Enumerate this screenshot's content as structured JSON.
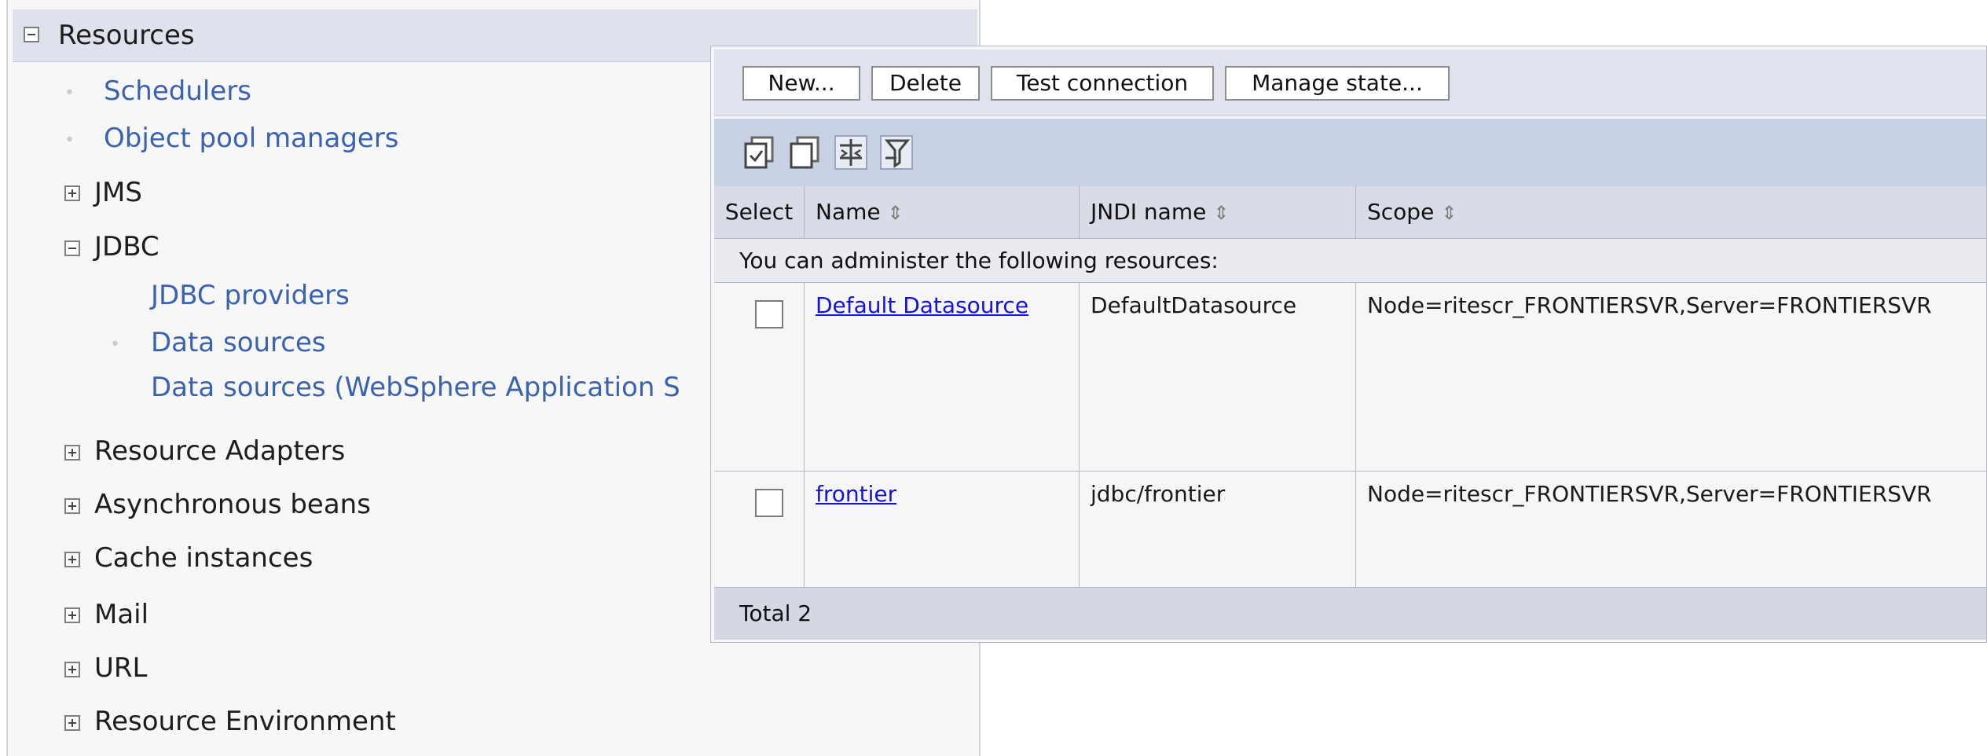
{
  "nav": {
    "header": {
      "label": "Resources"
    },
    "scheduling_links": [
      {
        "label": "Schedulers"
      },
      {
        "label": "Object pool managers"
      }
    ],
    "jms": {
      "label": "JMS"
    },
    "jdbc": {
      "label": "JDBC",
      "children": [
        {
          "label": "JDBC providers"
        },
        {
          "label": "Data sources"
        },
        {
          "label": "Data sources (WebSphere Application S"
        }
      ]
    },
    "more_categories": [
      {
        "label": "Resource Adapters"
      },
      {
        "label": "Asynchronous beans"
      },
      {
        "label": "Cache instances"
      },
      {
        "label": "Mail"
      },
      {
        "label": "URL"
      },
      {
        "label": "Resource Environment"
      }
    ]
  },
  "panel": {
    "buttons": [
      {
        "label": "New..."
      },
      {
        "label": "Delete"
      },
      {
        "label": "Test connection"
      },
      {
        "label": "Manage state..."
      }
    ],
    "icon_buttons": [
      "select-all-icon",
      "deselect-all-icon",
      "show-filter-icon",
      "clear-filter-icon"
    ],
    "columns": {
      "select": "Select",
      "name": "Name",
      "jndi": "JNDI name",
      "scope": "Scope",
      "sort_icon": "⇕"
    },
    "admin_note": "You can administer the following resources:",
    "rows": [
      {
        "name": "Default Datasource",
        "jndi": "DefaultDatasource",
        "scope": "Node=ritescr_FRONTIERSVR,Server=FRONTIERSVR"
      },
      {
        "name": "frontier",
        "jndi": "jdbc/frontier",
        "scope": "Node=ritescr_FRONTIERSVR,Server=FRONTIERSVR"
      }
    ],
    "total": "Total 2"
  },
  "colors": {
    "link": "#3a62ad",
    "resource_link": "#1414d6",
    "header_bg": "#dfe1ec",
    "toolbar_bg": "#c9d1e5"
  }
}
